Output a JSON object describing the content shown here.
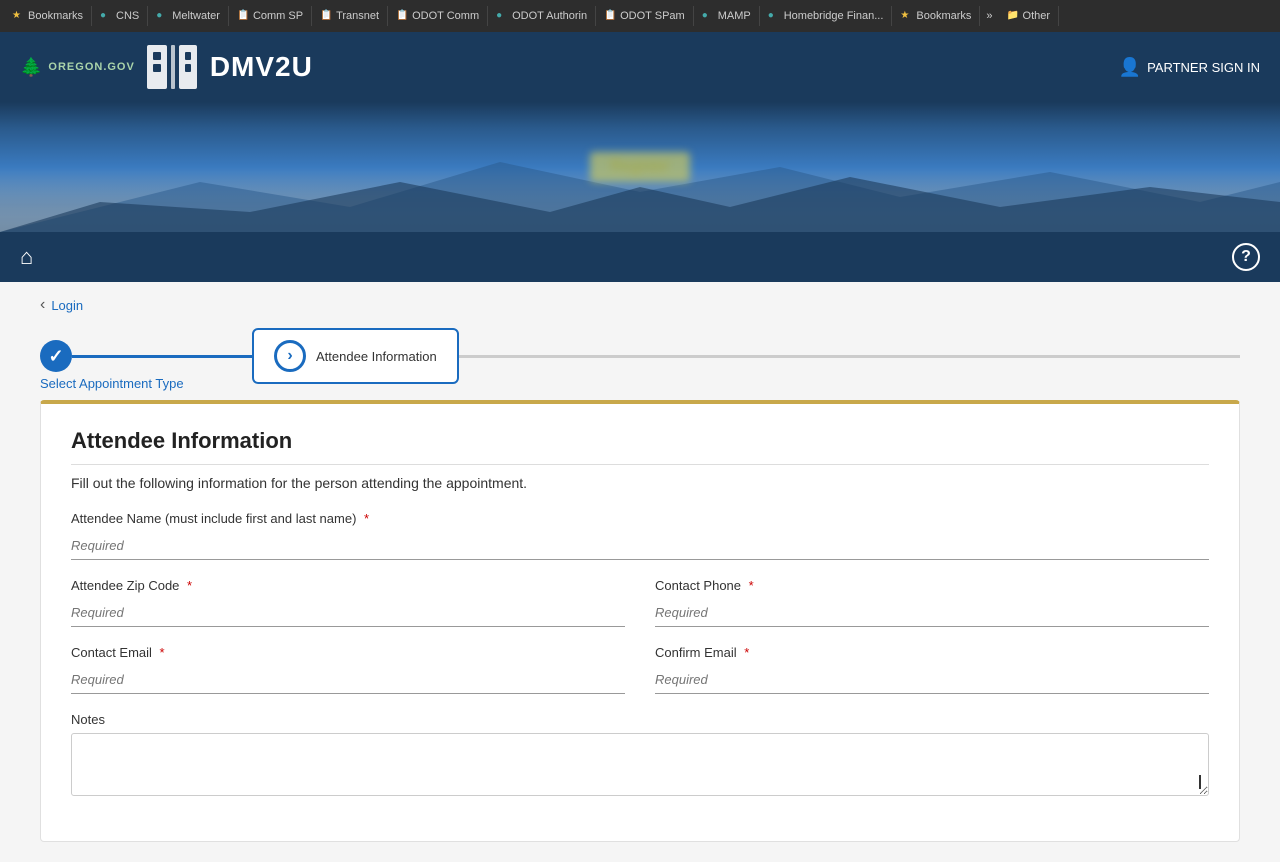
{
  "browser": {
    "tabs": [
      {
        "id": "bookmarks1",
        "icon": "★",
        "label": "Bookmarks",
        "type": "star"
      },
      {
        "id": "cns",
        "icon": "●",
        "label": "CNS",
        "type": "globe"
      },
      {
        "id": "meltwater",
        "icon": "●",
        "label": "Meltwater",
        "type": "globe"
      },
      {
        "id": "commsp",
        "icon": "📋",
        "label": "Comm SP",
        "type": "clip"
      },
      {
        "id": "transnet",
        "icon": "📋",
        "label": "Transnet",
        "type": "clip"
      },
      {
        "id": "odotcomm",
        "icon": "📋",
        "label": "ODOT Comm",
        "type": "clip"
      },
      {
        "id": "odotauth",
        "icon": "●",
        "label": "ODOT Authorin",
        "type": "coin"
      },
      {
        "id": "odotspam",
        "icon": "📋",
        "label": "ODOT SPam",
        "type": "clip"
      },
      {
        "id": "mamp",
        "icon": "●",
        "label": "MAMP",
        "type": "globe"
      },
      {
        "id": "homebridge",
        "icon": "●",
        "label": "Homebridge Finan...",
        "type": "globe"
      },
      {
        "id": "bookmarks2",
        "icon": "★",
        "label": "Bookmarks",
        "type": "star"
      }
    ],
    "more_label": "»",
    "other_label": "Other"
  },
  "header": {
    "oregon_gov": "OREGON.GOV",
    "partner_sign_in": "PARTNER SIGN IN",
    "app_name": "DMV2U"
  },
  "hero": {
    "blurred_label": "Register"
  },
  "nav": {
    "home_icon": "⌂",
    "help_icon": "?"
  },
  "breadcrumb": {
    "arrow": "‹",
    "text": "Login"
  },
  "stepper": {
    "step1": {
      "label": "Select Appointment Type",
      "done": true
    },
    "step2": {
      "label": "Attendee Information",
      "active": true
    }
  },
  "form": {
    "title": "Attendee Information",
    "description": "Fill out the following information for the person attending the appointment.",
    "fields": {
      "attendee_name": {
        "label": "Attendee Name (must include first and last name)",
        "placeholder": "Required",
        "required": true
      },
      "attendee_zip": {
        "label": "Attendee Zip Code",
        "placeholder": "Required",
        "required": true
      },
      "contact_phone": {
        "label": "Contact Phone",
        "placeholder": "Required",
        "required": true
      },
      "contact_email": {
        "label": "Contact Email",
        "placeholder": "Required",
        "required": true
      },
      "confirm_email": {
        "label": "Confirm Email",
        "placeholder": "Required",
        "required": true
      },
      "notes": {
        "label": "Notes",
        "placeholder": ""
      }
    }
  }
}
